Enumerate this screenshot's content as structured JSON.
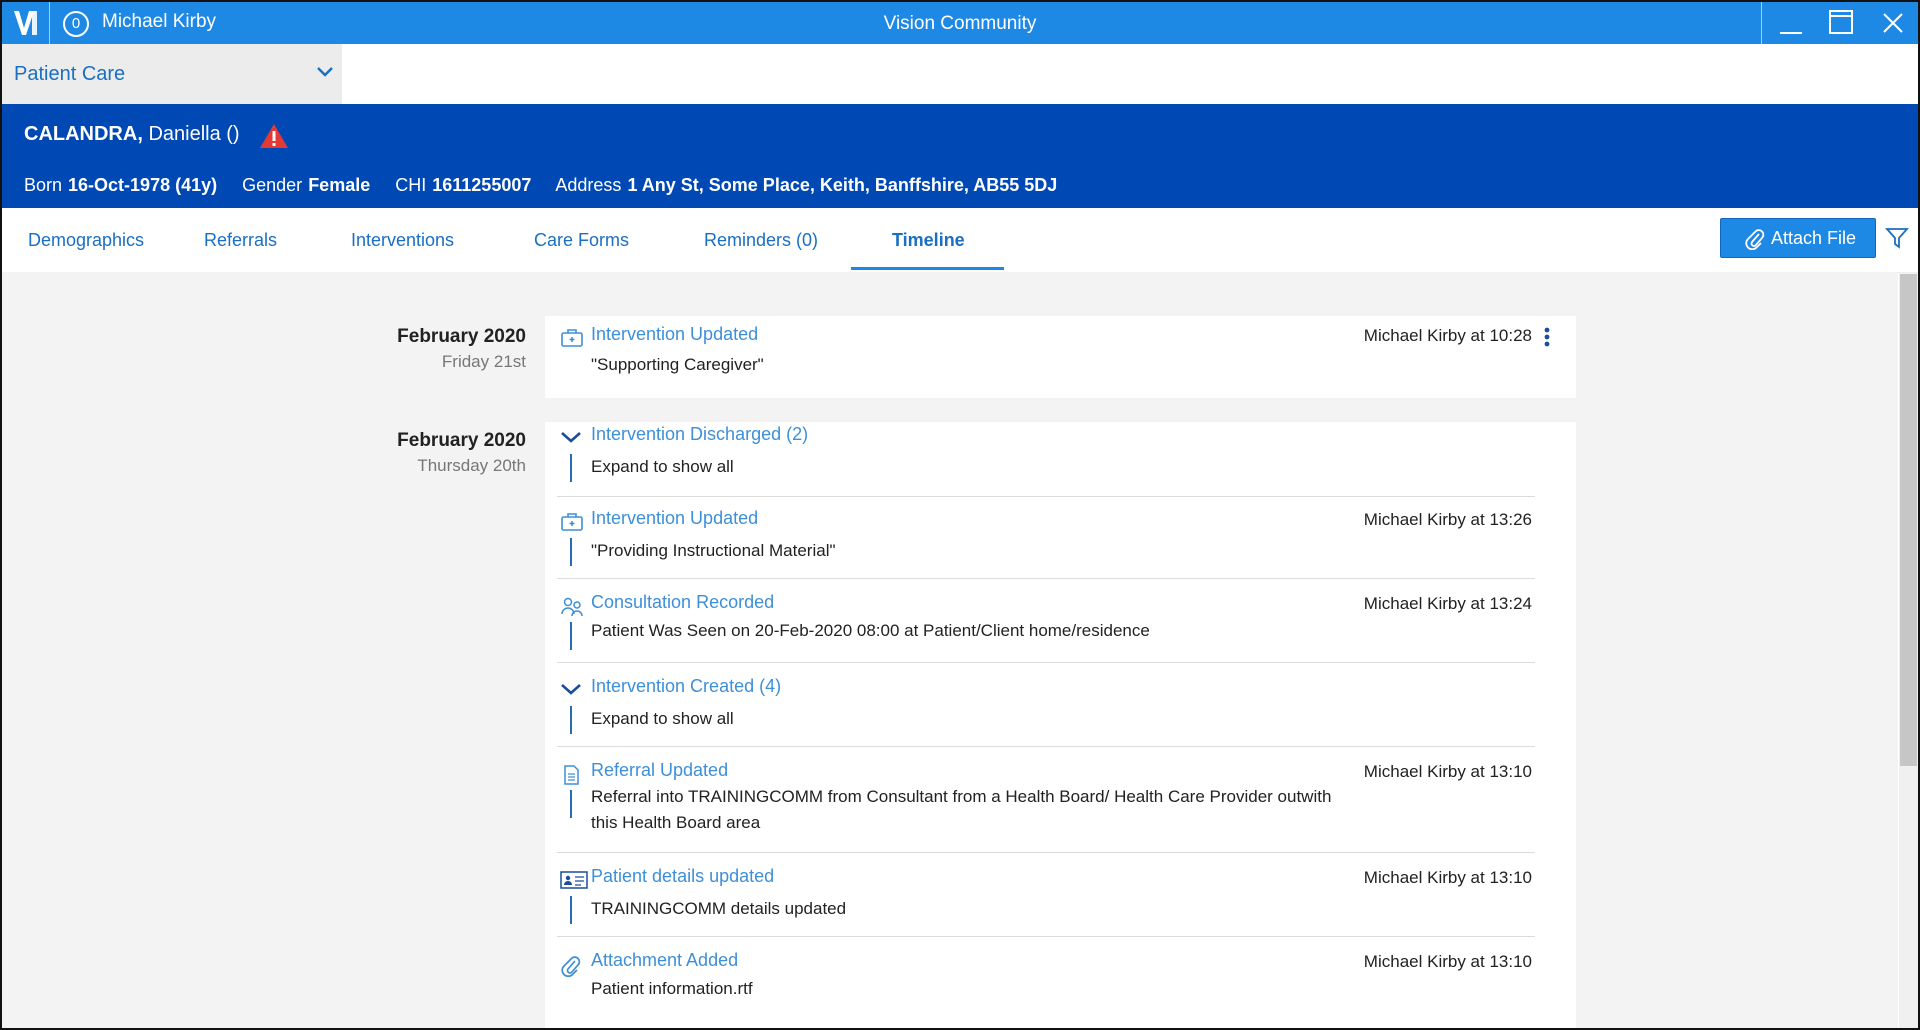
{
  "titlebar": {
    "badge": "0",
    "user": "Michael Kirby",
    "app_title": "Vision Community"
  },
  "module": {
    "selected": "Patient Care"
  },
  "patient": {
    "surname": "CALANDRA,",
    "forename": "Daniella ()",
    "born_label": "Born",
    "born_value": "16-Oct-1978 (41y)",
    "gender_label": "Gender",
    "gender_value": "Female",
    "chi_label": "CHI",
    "chi_value": "1611255007",
    "address_label": "Address",
    "address_value": "1 Any St, Some Place, Keith, Banffshire, AB55 5DJ"
  },
  "tabs": [
    {
      "label": "Demographics"
    },
    {
      "label": "Referrals"
    },
    {
      "label": "Interventions"
    },
    {
      "label": "Care Forms"
    },
    {
      "label": "Reminders (0)"
    },
    {
      "label": "Timeline"
    }
  ],
  "active_tab": "Timeline",
  "attach_button": "Attach File",
  "timeline": {
    "days": [
      {
        "month": "February 2020",
        "day": "Friday 21st",
        "entries": [
          {
            "icon": "intervention-icon",
            "title": "Intervention Updated",
            "meta": "Michael Kirby at 10:28",
            "body": "\"Supporting Caregiver\""
          }
        ]
      },
      {
        "month": "February 2020",
        "day": "Thursday 20th",
        "entries": [
          {
            "icon": "chevron-down-icon",
            "title": "Intervention Discharged (2)",
            "meta": "",
            "body": "Expand to show all"
          },
          {
            "icon": "intervention-icon",
            "title": "Intervention Updated",
            "meta": "Michael Kirby at 13:26",
            "body": "\"Providing Instructional Material\""
          },
          {
            "icon": "consultation-icon",
            "title": "Consultation Recorded",
            "meta": "Michael Kirby at 13:24",
            "body": "Patient Was Seen on 20-Feb-2020 08:00 at Patient/Client home/residence"
          },
          {
            "icon": "chevron-down-icon",
            "title": "Intervention Created (4)",
            "meta": "",
            "body": "Expand to show all"
          },
          {
            "icon": "document-icon",
            "title": "Referral Updated",
            "meta": "Michael Kirby at 13:10",
            "body": "Referral into TRAININGCOMM from Consultant from a Health Board/ Health Care Provider outwith this Health Board area"
          },
          {
            "icon": "id-card-icon",
            "title": "Patient details updated",
            "meta": "Michael Kirby at 13:10",
            "body": "TRAININGCOMM details updated"
          },
          {
            "icon": "paperclip-icon",
            "title": "Attachment Added",
            "meta": "Michael Kirby at 13:10",
            "body": "Patient information.rtf"
          }
        ]
      }
    ]
  },
  "colors": {
    "titlebar": "#1e88e5",
    "banner": "#0048b3",
    "link": "#3d8fd8",
    "warning": "#e53935"
  }
}
